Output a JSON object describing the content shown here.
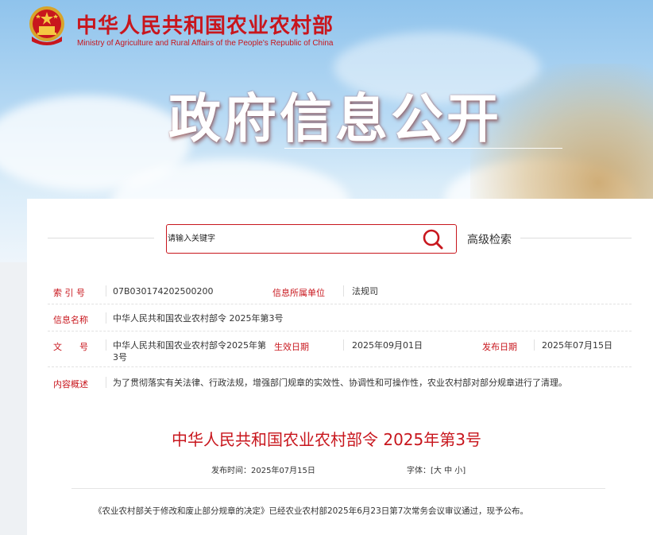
{
  "header": {
    "site_name_cn": "中华人民共和国农业农村部",
    "site_name_en": "Ministry of Agriculture and Rural Affairs of the People's Republic of China",
    "emblem_icon": "national-emblem-icon",
    "banner_title": "政府信息公开"
  },
  "search": {
    "placeholder": "请输入关键字",
    "button_icon": "search-icon",
    "advanced_label": "高级检索"
  },
  "metadata": {
    "index_label": "索 引 号",
    "index_value": "07B030174202500200",
    "dept_label": "信息所属单位",
    "dept_value": "法规司",
    "name_label": "信息名称",
    "name_value": "中华人民共和国农业农村部令 2025年第3号",
    "docno_label": "文　　号",
    "docno_value_line1": "中华人民共和国农业农村部令2025年第",
    "docno_value_line2": "3号",
    "effective_label": "生效日期",
    "effective_value": "2025年09月01日",
    "publish_label": "发布日期",
    "publish_value": "2025年07月15日",
    "summary_label": "内容概述",
    "summary_value": "为了贯彻落实有关法律、行政法规，增强部门规章的实效性、协调性和可操作性，农业农村部对部分规章进行了清理。"
  },
  "document": {
    "title": "中华人民共和国农业农村部令 2025年第3号",
    "publish_time_label": "发布时间：",
    "publish_time_value": "2025年07月15日",
    "font_label": "字体：",
    "font_open": "[",
    "font_large": "大",
    "font_medium": "中",
    "font_small": "小",
    "font_close": "]",
    "body_text": "《农业农村部关于修改和废止部分规章的决定》已经农业农村部2025年6月23日第7次常务会议审议通过，现予公布。"
  },
  "colors": {
    "brand_red": "#c8161d",
    "text": "#333333",
    "background": "#eef1f4"
  }
}
